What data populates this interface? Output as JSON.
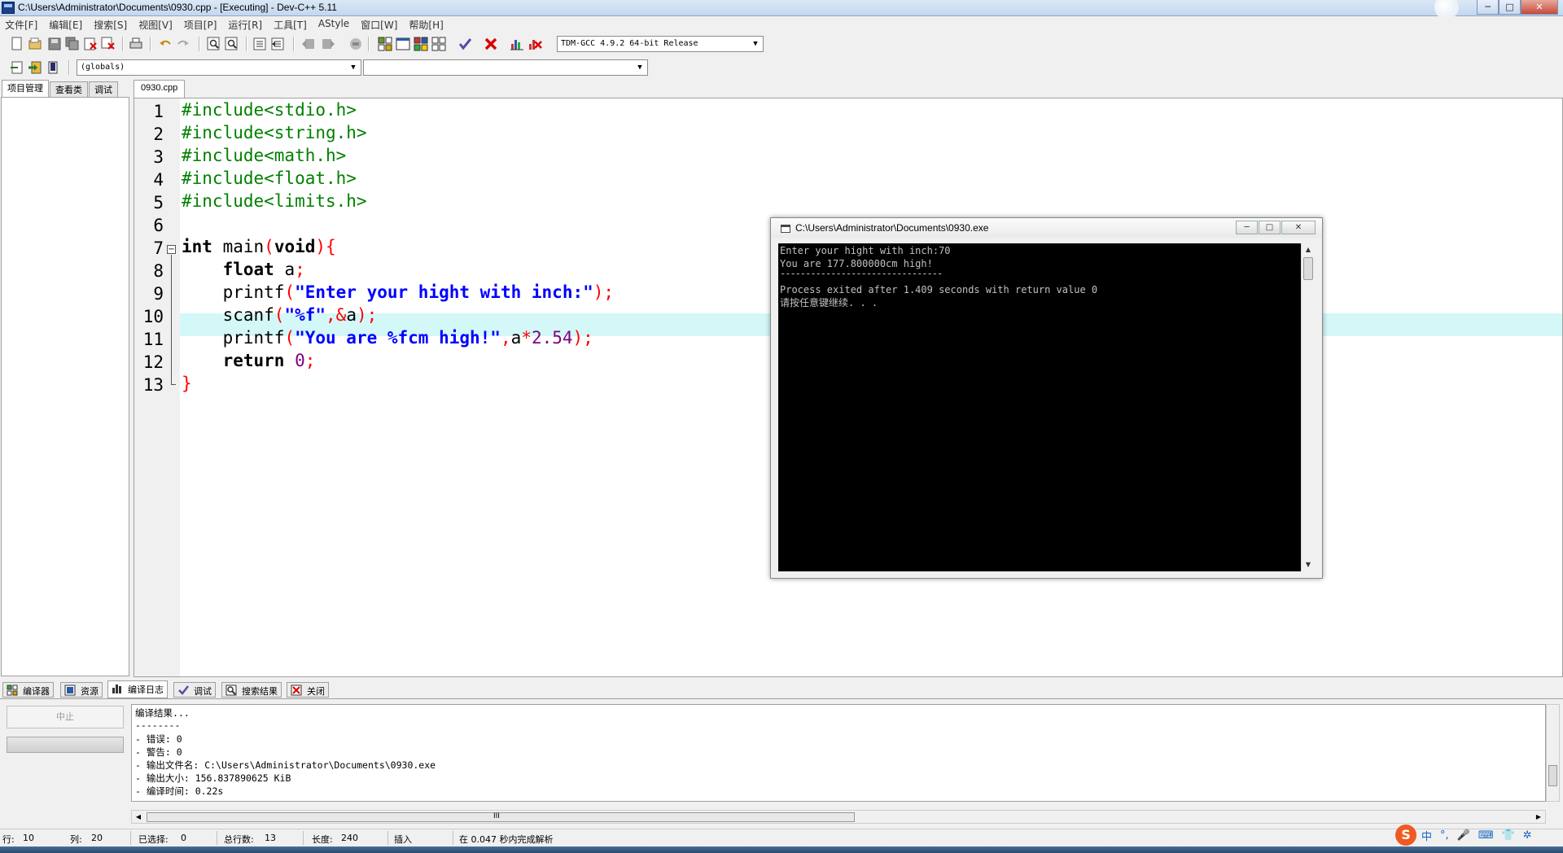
{
  "window": {
    "title": "C:\\Users\\Administrator\\Documents\\0930.cpp - [Executing] - Dev-C++ 5.11",
    "min_label": "─",
    "max_label": "□",
    "close_label": "✕"
  },
  "menu": [
    "文件[F]",
    "编辑[E]",
    "搜索[S]",
    "视图[V]",
    "项目[P]",
    "运行[R]",
    "工具[T]",
    "AStyle",
    "窗口[W]",
    "帮助[H]"
  ],
  "toolbar": {
    "compiler_select": "TDM-GCC 4.9.2 64-bit Release",
    "scope_select": "(globals)",
    "member_select": ""
  },
  "left_panel": {
    "tabs": [
      "项目管理",
      "查看类",
      "调试"
    ]
  },
  "editor": {
    "file_tab": "0930.cpp",
    "line_numbers": [
      "1",
      "2",
      "3",
      "4",
      "5",
      "6",
      "7",
      "8",
      "9",
      "10",
      "11",
      "12",
      "13"
    ],
    "fold_minus": "−"
  },
  "code": {
    "l1": "#include<stdio.h>",
    "l2": "#include<string.h>",
    "l3": "#include<math.h>",
    "l4": "#include<float.h>",
    "l5": "#include<limits.h>",
    "l7_kw": "int",
    "l7_id": " main",
    "l7_p1": "(",
    "l7_kw2": "void",
    "l7_p2": "){",
    "l8_kw": "    float",
    "l8_id": " a",
    "l8_s": ";",
    "l9_id": "    printf",
    "l9_p1": "(",
    "l9_str": "\"Enter your hight with inch:\"",
    "l9_p2": ");",
    "l10_id": "    scanf",
    "l10_p1": "(",
    "l10_str": "\"%f\"",
    "l10_op": ",&",
    "l10_a": "a",
    "l10_p2": ");",
    "l11_id": "    printf",
    "l11_p1": "(",
    "l11_str": "\"You are %fcm high!\"",
    "l11_c": ",",
    "l11_a": "a",
    "l11_op": "*",
    "l11_num": "2.54",
    "l11_p2": ");",
    "l12_kw": "    return",
    "l12_sp": " ",
    "l12_num": "0",
    "l12_s": ";",
    "l13": "}"
  },
  "console": {
    "title": "C:\\Users\\Administrator\\Documents\\0930.exe",
    "lines": [
      "Enter your hight with inch:70",
      "You are 177.800000cm high!",
      "--------------------------------",
      "Process exited after 1.409 seconds with return value 0",
      "请按任意键继续. . ."
    ],
    "min_label": "─",
    "max_label": "□",
    "close_label": "✕"
  },
  "bottom_tabs": [
    "编译器",
    "资源",
    "编译日志",
    "调试",
    "搜索结果",
    "关闭"
  ],
  "bottom": {
    "abort_label": "中止",
    "log_lines": [
      "编译结果...",
      "--------",
      "- 错误: 0",
      "- 警告: 0",
      "- 输出文件名: C:\\Users\\Administrator\\Documents\\0930.exe",
      "- 输出大小: 156.837890625 KiB",
      "- 编译时间: 0.22s"
    ],
    "scroll_grip": "III"
  },
  "status": {
    "row_label": "行:",
    "row_value": "10",
    "col_label": "列:",
    "col_value": "20",
    "sel_label": "已选择:",
    "sel_value": "0",
    "total_label": "总行数:",
    "total_value": "13",
    "len_label": "长度:",
    "len_value": "240",
    "mode": "插入",
    "parse_msg": "在 0.047 秒内完成解析"
  },
  "ime": {
    "logo": "S",
    "lang": "中",
    "punct": "°,",
    "mic": "🎤",
    "kbd": "⌨",
    "skin": "👕",
    "tools": "✲"
  },
  "colors": {
    "include": "#008000",
    "string": "#0000ff",
    "symbol": "#ff0000",
    "number": "#800080",
    "current_line": "#d4f7f7"
  }
}
